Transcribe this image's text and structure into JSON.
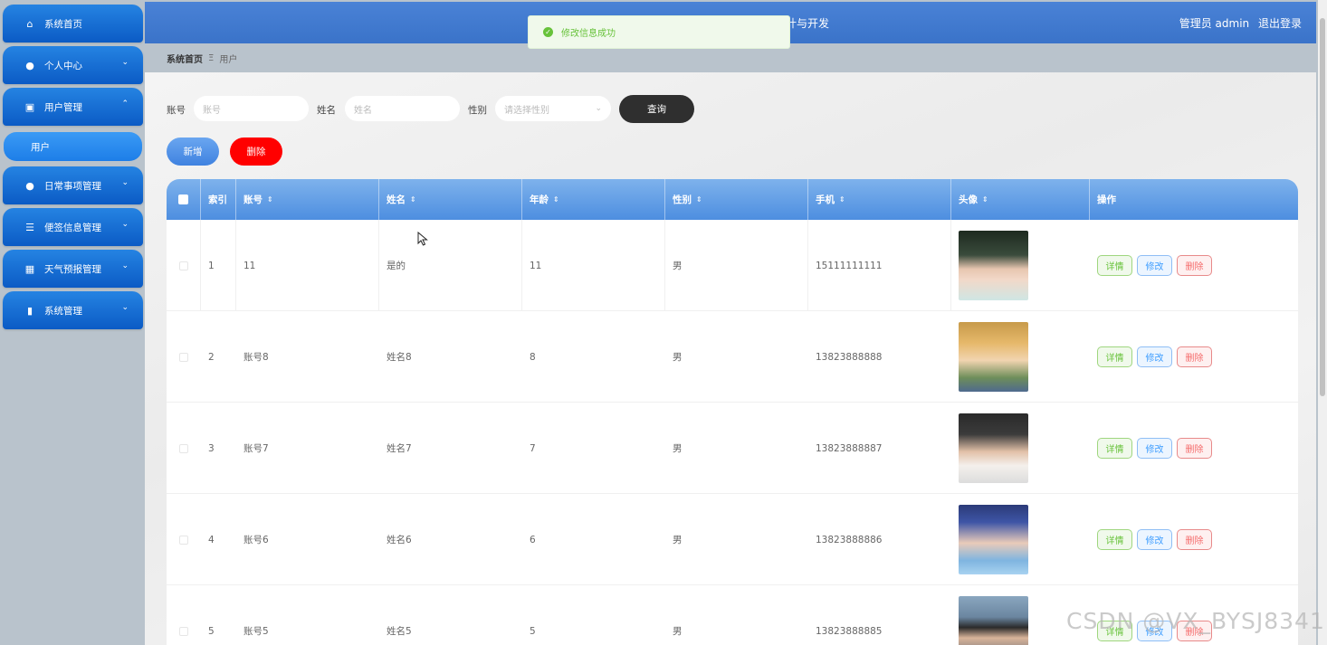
{
  "header": {
    "title_fragment": "计与开发",
    "user_label": "管理员 admin",
    "logout_label": "退出登录"
  },
  "toast": {
    "message": "修改信息成功"
  },
  "sidebar": {
    "items": [
      {
        "label": "系统首页",
        "icon": "home-icon"
      },
      {
        "label": "个人中心",
        "icon": "user-icon"
      },
      {
        "label": "用户管理",
        "icon": "clipboard-icon"
      },
      {
        "label": "日常事项管理",
        "icon": "user-icon"
      },
      {
        "label": "便签信息管理",
        "icon": "sliders-icon"
      },
      {
        "label": "天气预报管理",
        "icon": "grid-icon"
      },
      {
        "label": "系统管理",
        "icon": "bar-chart-icon"
      }
    ],
    "sub_item": "用户"
  },
  "breadcrumb": {
    "home": "系统首页",
    "separator": "Ξ",
    "current": "用户"
  },
  "search": {
    "account_label": "账号",
    "account_placeholder": "账号",
    "name_label": "姓名",
    "name_placeholder": "姓名",
    "gender_label": "性别",
    "gender_placeholder": "请选择性别",
    "query_button": "查询"
  },
  "actions": {
    "add_button": "新增",
    "delete_button": "删除"
  },
  "table": {
    "headers": [
      "索引",
      "账号",
      "姓名",
      "年龄",
      "性别",
      "手机",
      "头像",
      "操作"
    ],
    "ops": {
      "detail": "详情",
      "edit": "修改",
      "delete": "删除"
    },
    "rows": [
      {
        "index": "1",
        "account": "11",
        "name": "是的",
        "age": "11",
        "gender": "男",
        "phone": "15111111111"
      },
      {
        "index": "2",
        "account": "账号8",
        "name": "姓名8",
        "age": "8",
        "gender": "男",
        "phone": "13823888888"
      },
      {
        "index": "3",
        "account": "账号7",
        "name": "姓名7",
        "age": "7",
        "gender": "男",
        "phone": "13823888887"
      },
      {
        "index": "4",
        "account": "账号6",
        "name": "姓名6",
        "age": "6",
        "gender": "男",
        "phone": "13823888886"
      },
      {
        "index": "5",
        "account": "账号5",
        "name": "姓名5",
        "age": "5",
        "gender": "男",
        "phone": "13823888885"
      }
    ]
  },
  "watermark": "CSDN @VX_BYSJ8341",
  "colors": {
    "nav_blue": "#0b5bc5",
    "topbar_blue": "#3a73c9",
    "query_dark": "#2f2f2f",
    "add_blue": "#4f8fe6",
    "delete_red": "#ff0000"
  }
}
